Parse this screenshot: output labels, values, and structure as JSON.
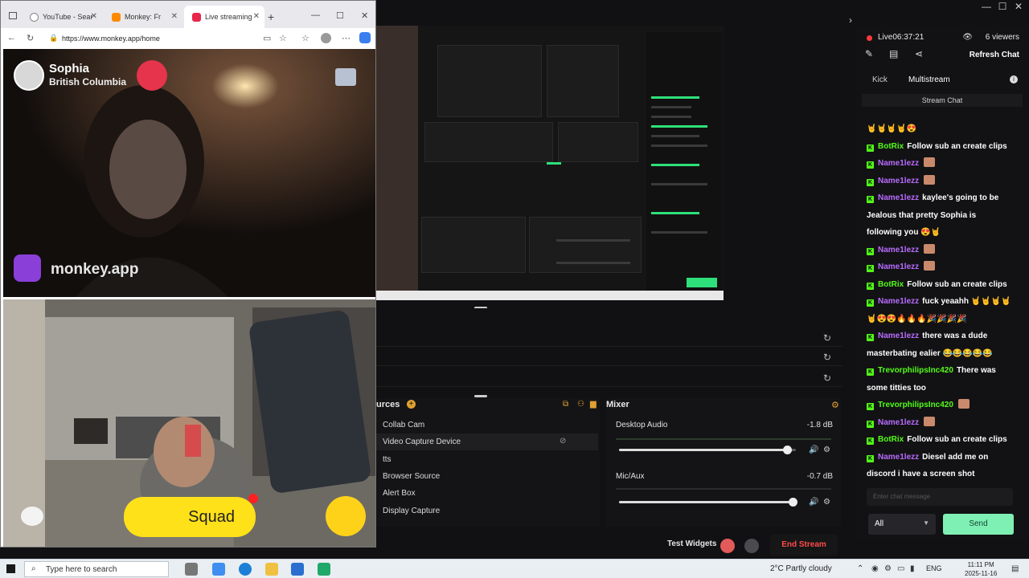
{
  "browser": {
    "tabs": [
      {
        "label": "YouTube - Sear",
        "color": "#ff0000"
      },
      {
        "label": "Monkey: Fr",
        "color": "#e0442b"
      },
      {
        "label": "Live streaming",
        "color": "#ff2b5b"
      }
    ],
    "url": "https://www.monkey.app/home"
  },
  "video_call": {
    "user_name": "Sophia",
    "user_location": "British Columbia",
    "brand": "monkey.app",
    "squad_label": "Squad"
  },
  "streaming_app": {
    "sources_title": "urces",
    "sources": [
      "Collab Cam",
      "Video Capture Device",
      "tts",
      "Browser Source",
      "Alert Box",
      "Display Capture"
    ],
    "mixer_title": "Mixer",
    "mixer": [
      {
        "name": "Desktop Audio",
        "db": "-1.8 dB",
        "level": 0.95
      },
      {
        "name": "Mic/Aux",
        "db": "-0.7 dB",
        "level": 0.98
      }
    ],
    "test_widgets": "Test Widgets",
    "end_stream": "End Stream"
  },
  "chat": {
    "live_status": "Live06:37:21",
    "viewers": "6 viewers",
    "refresh": "Refresh Chat",
    "tabs": [
      "Kick",
      "Multistream"
    ],
    "section": "Stream Chat",
    "messages": [
      {
        "user": "",
        "text": "🤘🤘🤘🤘😍"
      },
      {
        "user": "BotRix",
        "text": "Follow sub an create clips",
        "color": "green"
      },
      {
        "user": "Name1lezz",
        "text": "",
        "color": "purple"
      },
      {
        "user": "Name1lezz",
        "text": "",
        "color": "purple"
      },
      {
        "user": "Name1lezz",
        "text": "kaylee's going to be",
        "color": "purple"
      },
      {
        "user": "",
        "text": "Jealous that pretty Sophia is"
      },
      {
        "user": "",
        "text": "following you 😍🤘"
      },
      {
        "user": "Name1lezz",
        "text": "",
        "color": "purple"
      },
      {
        "user": "Name1lezz",
        "text": "",
        "color": "purple"
      },
      {
        "user": "BotRix",
        "text": "Follow sub an create clips",
        "color": "green"
      },
      {
        "user": "Name1lezz",
        "text": "fuck yeaahh 🤘🤘🤘🤘",
        "color": "purple"
      },
      {
        "user": "",
        "text": "🤘😍😍🔥🔥🔥🎉🎉🎉🎉"
      },
      {
        "user": "Name1lezz",
        "text": "there was a dude",
        "color": "purple"
      },
      {
        "user": "",
        "text": "masterbating ealier 😂😂😂😂😂"
      },
      {
        "user": "TrevorphilipsInc420",
        "text": "There was",
        "color": "green"
      },
      {
        "user": "",
        "text": "some titties too"
      },
      {
        "user": "TrevorphilipsInc420",
        "text": "",
        "color": "green"
      },
      {
        "user": "Name1lezz",
        "text": "",
        "color": "purple"
      },
      {
        "user": "BotRix",
        "text": "Follow sub an create clips",
        "color": "green"
      },
      {
        "user": "Name1lezz",
        "text": "Diesel add me on",
        "color": "purple"
      },
      {
        "user": "",
        "text": "discord i have a screen shot"
      }
    ],
    "input_placeholder": "Enter chat message",
    "filter": "All",
    "send": "Send"
  },
  "taskbar": {
    "search_placeholder": "Type here to search",
    "weather": "2°C  Partly cloudy",
    "lang": "ENG",
    "time": "11:11 PM",
    "date": "2025-11-16"
  }
}
